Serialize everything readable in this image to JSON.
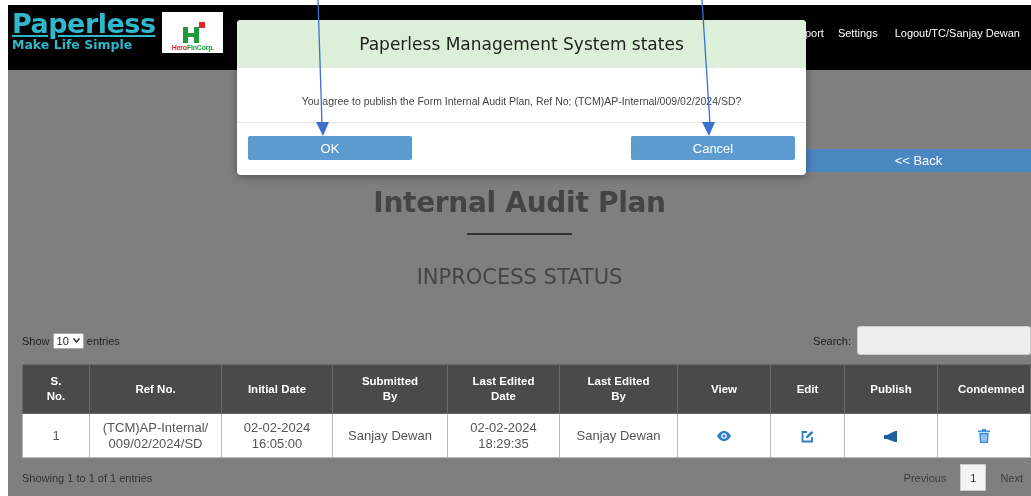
{
  "header": {
    "logo": {
      "title": "Paperless",
      "tagline": "Make Life Simple"
    },
    "partner_logo": {
      "text_parts": [
        {
          "text": "Hero",
          "color": "#e0262b"
        },
        {
          "text": "FinCorp.",
          "color": "#1e9a3c"
        }
      ]
    },
    "nav": [
      "port",
      "Settings",
      "Logout/TC/Sanjay Dewan"
    ]
  },
  "back_button": "<< Back",
  "page_title": "Internal Audit Plan",
  "status_heading": "INPROCESS STATUS",
  "table_controls": {
    "show_label": "Show",
    "page_size": "10",
    "entries_label": "entries",
    "search_label": "Search:"
  },
  "table": {
    "columns": [
      "S. No.",
      "Ref No.",
      "Initial Date",
      "Submitted By",
      "Last Edited Date",
      "Last Edited By",
      "View",
      "Edit",
      "Publish",
      "Condemned"
    ],
    "rows": [
      {
        "cells": [
          {
            "kind": "text",
            "text": "1"
          },
          {
            "kind": "text",
            "text": "(TCM)AP-Internal/009/02/2024/SD"
          },
          {
            "kind": "text",
            "text": "02-02-2024 16:05:00"
          },
          {
            "kind": "text",
            "text": "Sanjay Dewan"
          },
          {
            "kind": "text",
            "text": "02-02-2024 18:29:35"
          },
          {
            "kind": "text",
            "text": "Sanjay Dewan"
          },
          {
            "kind": "view"
          },
          {
            "kind": "edit"
          },
          {
            "kind": "publish"
          },
          {
            "kind": "delete"
          }
        ]
      }
    ]
  },
  "footer": {
    "info": "Showing 1 to 1 of 1 entries",
    "previous": {
      "label": "Previous",
      "disabled": true
    },
    "pages": [
      {
        "label": "1",
        "selected": true
      }
    ],
    "next": {
      "label": "Next",
      "disabled": true
    }
  },
  "dialog": {
    "title": "Paperless Management System states",
    "message": "You agree to publish the Form Internal Audit Plan, Ref No: (TCM)AP-Internal/009/02/2024/SD?",
    "buttons": [
      {
        "label": "OK",
        "arrow": true
      },
      {
        "label": "Cancel",
        "arrow": true
      }
    ]
  }
}
